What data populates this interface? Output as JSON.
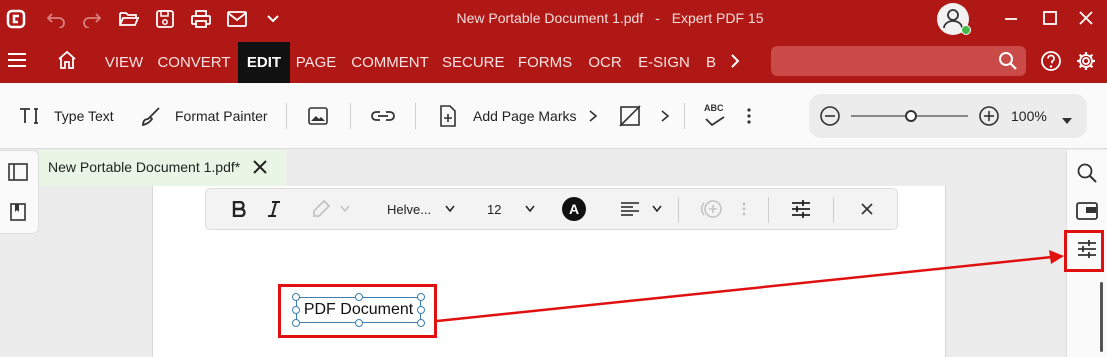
{
  "titlebar": {
    "doc_title": "New Portable Document 1.pdf",
    "separator": "-",
    "app_name": "Expert PDF 15"
  },
  "menubar": {
    "tabs": [
      "VIEW",
      "CONVERT",
      "EDIT",
      "PAGE",
      "COMMENT",
      "SECURE",
      "FORMS",
      "OCR",
      "E-SIGN",
      "B"
    ],
    "active_tab": "EDIT",
    "search_placeholder": ""
  },
  "toolbar": {
    "type_text_label": "Type Text",
    "format_painter_label": "Format Painter",
    "add_page_marks_label": "Add Page Marks",
    "spellcheck_glyph": "ABC",
    "zoom_value": "100%"
  },
  "doc_tab": {
    "label": "New Portable Document 1.pdf*"
  },
  "edit_bar": {
    "font_name": "Helve...",
    "font_size": "12",
    "color_glyph": "A"
  },
  "page": {
    "text_box": "PDF Document"
  },
  "colors": {
    "brand_red": "#b01815",
    "highlight": "#e01010",
    "tab_active_bg": "#111111",
    "doc_tab_bg": "#eaf6e5"
  },
  "icons": [
    "app-logo-icon",
    "undo-icon",
    "redo-icon",
    "open-folder-icon",
    "save-icon",
    "print-icon",
    "mail-icon",
    "chevron-down-icon",
    "user-icon",
    "minimize-icon",
    "maximize-icon",
    "close-icon",
    "hamburger-icon",
    "home-icon",
    "search-icon",
    "help-icon",
    "settings-icon",
    "zoom-out-icon",
    "zoom-in-icon",
    "sidebar-panel-icon",
    "bookmark-icon",
    "properties-icon"
  ]
}
